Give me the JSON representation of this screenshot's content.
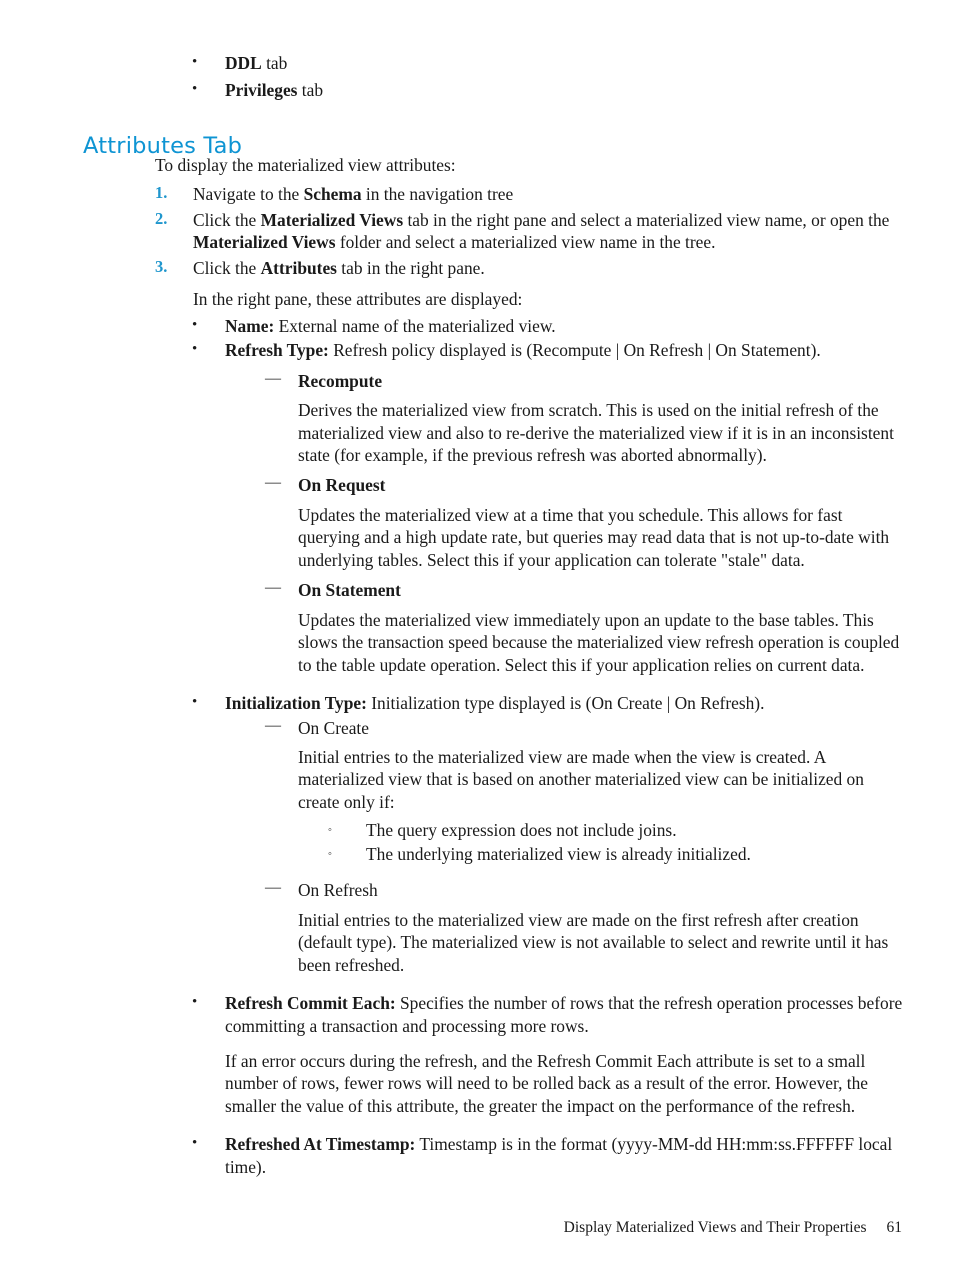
{
  "document": {
    "heading": "Attributes Tab",
    "heading_color": "#0e94d3",
    "marker_color": "#1f96cd"
  },
  "top_bullets": [
    {
      "bullet": "•",
      "bold": "DDL",
      "rest": " tab"
    },
    {
      "bullet": "•",
      "bold": "Privileges",
      "rest": " tab"
    }
  ],
  "intro": "To display the materialized view attributes:",
  "steps": [
    {
      "number": "1.",
      "pre": "Navigate to the ",
      "bold": "Schema",
      "post": " in the navigation tree"
    },
    {
      "number": "2.",
      "pre": "Click the ",
      "bold": "Materialized Views",
      "post": " tab in the right pane and select a materialized view name, or open the ",
      "bold2": "Materialized Views",
      "post2": " folder and select a materialized view name in the tree."
    },
    {
      "number": "3.",
      "pre": "Click the ",
      "bold": "Attributes",
      "post": " tab in the right pane."
    }
  ],
  "sub_intro": "In the right pane, these attributes are displayed:",
  "attributes": {
    "name": {
      "bullet": "•",
      "label": "Name:",
      "text": " External name of the materialized view."
    },
    "refresh_type": {
      "bullet": "•",
      "label": "Refresh Type:",
      "text": " Refresh policy displayed is (Recompute | On Refresh | On Statement).",
      "items": [
        {
          "dash": "—",
          "head": "Recompute",
          "head_bold": true,
          "para": "Derives the materialized view from scratch. This is used on the initial refresh of the materialized view and also to re-derive the materialized view if it is in an inconsistent state (for example, if the previous refresh was aborted abnormally)."
        },
        {
          "dash": "—",
          "head": "On Request",
          "head_bold": true,
          "para": "Updates the materialized view at a time that you schedule. This allows for fast querying and a high update rate, but queries may read data that is not up-to-date with underlying tables. Select this if your application can tolerate \"stale\" data."
        },
        {
          "dash": "—",
          "head": "On Statement",
          "head_bold": true,
          "para": "Updates the materialized view immediately upon an update to the base tables. This slows the transaction speed because the materialized view refresh operation is coupled to the table update operation. Select this if your application relies on current data."
        }
      ]
    },
    "initialization_type": {
      "bullet": "•",
      "label": "Initialization Type:",
      "text": " Initialization type displayed is (On Create | On Refresh).",
      "items": [
        {
          "dash": "—",
          "head": "On Create",
          "head_bold": false,
          "para": "Initial entries to the materialized view are made when the view is created. A materialized view that is based on another materialized view can be initialized on create only if:",
          "subitems": [
            {
              "bullet": "◦",
              "text": "The query expression does not include joins."
            },
            {
              "bullet": "◦",
              "text": "The underlying materialized view is already initialized."
            }
          ]
        },
        {
          "dash": "—",
          "head": "On Refresh",
          "head_bold": false,
          "para": "Initial entries to the materialized view are made on the first refresh after creation (default type). The materialized view is not available to select and rewrite until it has been refreshed."
        }
      ]
    },
    "refresh_commit_each": {
      "bullet": "•",
      "label": "Refresh Commit Each:",
      "text": " Specifies the number of rows that the refresh operation processes before committing a transaction and processing more rows.",
      "para": "If an error occurs during the refresh, and the Refresh Commit Each attribute is set to a small number of rows, fewer rows will need to be rolled back as a result of the error. However, the smaller the value of this attribute, the greater the impact on the performance of the refresh."
    },
    "refreshed_at_timestamp": {
      "bullet": "•",
      "label": "Refreshed At Timestamp:",
      "text": " Timestamp is in the format (yyyy-MM-dd HH:mm:ss.FFFFFF local time)."
    }
  },
  "footer": {
    "title": "Display Materialized Views and Their Properties",
    "page": "61"
  }
}
